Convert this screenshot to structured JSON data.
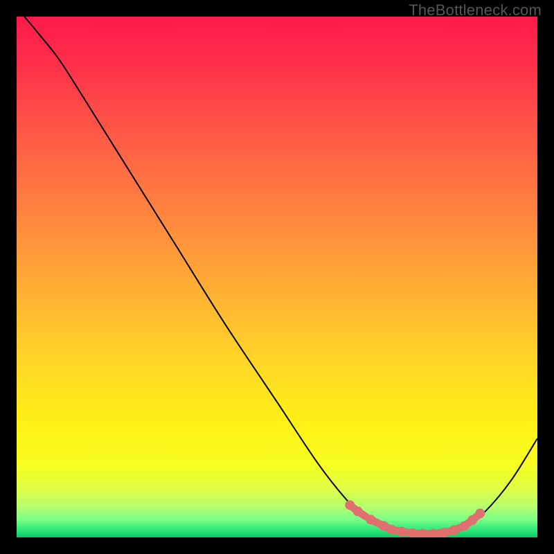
{
  "watermark": "TheBottleneck.com",
  "chart_data": {
    "type": "line",
    "title": "",
    "xlabel": "",
    "ylabel": "",
    "xlim": [
      0,
      100
    ],
    "ylim": [
      0,
      100
    ],
    "grid": false,
    "series": [
      {
        "name": "curve",
        "stroke": "#000000",
        "points": [
          {
            "x": 1.5,
            "y": 100
          },
          {
            "x": 4,
            "y": 97
          },
          {
            "x": 8,
            "y": 92
          },
          {
            "x": 12.5,
            "y": 85
          },
          {
            "x": 20,
            "y": 73
          },
          {
            "x": 30,
            "y": 57
          },
          {
            "x": 40,
            "y": 41
          },
          {
            "x": 50,
            "y": 26
          },
          {
            "x": 58,
            "y": 14
          },
          {
            "x": 64,
            "y": 6.5
          },
          {
            "x": 68,
            "y": 3
          },
          {
            "x": 72,
            "y": 1.2
          },
          {
            "x": 77,
            "y": 0.5
          },
          {
            "x": 82,
            "y": 0.7
          },
          {
            "x": 86,
            "y": 2
          },
          {
            "x": 90,
            "y": 5
          },
          {
            "x": 95,
            "y": 11
          },
          {
            "x": 100,
            "y": 19
          }
        ]
      }
    ],
    "markers": {
      "stroke": "#e07070",
      "fill": "#e07070",
      "points": [
        {
          "x": 64,
          "y": 6.2
        },
        {
          "x": 65.5,
          "y": 5.0
        },
        {
          "x": 68,
          "y": 3.4
        },
        {
          "x": 70.5,
          "y": 2.2
        },
        {
          "x": 72,
          "y": 1.5
        },
        {
          "x": 74,
          "y": 1.1
        },
        {
          "x": 76,
          "y": 0.8
        },
        {
          "x": 78,
          "y": 0.7
        },
        {
          "x": 80,
          "y": 0.7
        },
        {
          "x": 82,
          "y": 0.9
        },
        {
          "x": 84,
          "y": 1.4
        },
        {
          "x": 86,
          "y": 2.2
        },
        {
          "x": 87.5,
          "y": 3.3
        },
        {
          "x": 89,
          "y": 4.6
        }
      ]
    },
    "background_gradient": {
      "stops": [
        {
          "offset": 0.0,
          "color": "#ff1a49"
        },
        {
          "offset": 0.09,
          "color": "#ff2f4a"
        },
        {
          "offset": 0.2,
          "color": "#ff5247"
        },
        {
          "offset": 0.32,
          "color": "#ff7442"
        },
        {
          "offset": 0.44,
          "color": "#ff963b"
        },
        {
          "offset": 0.56,
          "color": "#ffb931"
        },
        {
          "offset": 0.68,
          "color": "#ffdb24"
        },
        {
          "offset": 0.78,
          "color": "#fff016"
        },
        {
          "offset": 0.86,
          "color": "#f7ff1f"
        },
        {
          "offset": 0.905,
          "color": "#e0ff45"
        },
        {
          "offset": 0.94,
          "color": "#b8ff6d"
        },
        {
          "offset": 0.965,
          "color": "#7dff86"
        },
        {
          "offset": 0.985,
          "color": "#30e879"
        },
        {
          "offset": 1.0,
          "color": "#0fc867"
        }
      ]
    }
  }
}
